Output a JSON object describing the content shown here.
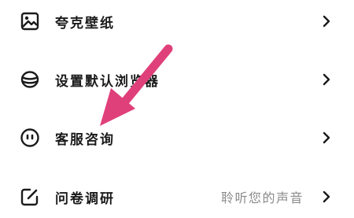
{
  "menu": {
    "items": [
      {
        "label": "夸克壁纸",
        "icon": "image-icon",
        "hint": ""
      },
      {
        "label": "设置默认浏览器",
        "icon": "browser-icon",
        "hint": ""
      },
      {
        "label": "客服咨询",
        "icon": "smiley-icon",
        "hint": ""
      },
      {
        "label": "问卷调研",
        "icon": "edit-icon",
        "hint": "聆听您的声音"
      }
    ]
  },
  "overlay": {
    "arrow_color": "#e0407a"
  }
}
